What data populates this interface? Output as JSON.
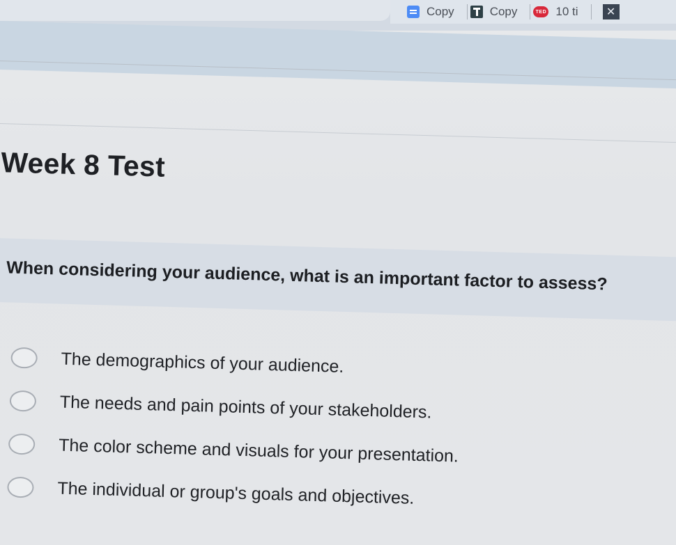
{
  "browser": {
    "tabs": [
      {
        "label": "Copy",
        "icon": "docs-icon"
      },
      {
        "label": "Copy",
        "icon": "plus-square-icon"
      },
      {
        "label": "10 ti",
        "icon": "ted-icon"
      }
    ],
    "ted_badge": "TED",
    "close_glyph": "✕"
  },
  "page": {
    "title": "Week 8 Test"
  },
  "question": {
    "text": "When considering your audience, what is an important factor to assess?",
    "options": [
      {
        "label": "The demographics of your audience.",
        "selected": false
      },
      {
        "label": "The needs and pain points of your stakeholders.",
        "selected": false
      },
      {
        "label": "The color scheme and visuals for your presentation.",
        "selected": false
      },
      {
        "label": "The individual or group's goals and objectives.",
        "selected": false
      }
    ]
  },
  "colors": {
    "question_bar": "#d7dde5",
    "background": "#e6e7e9",
    "text": "#1f2125"
  }
}
